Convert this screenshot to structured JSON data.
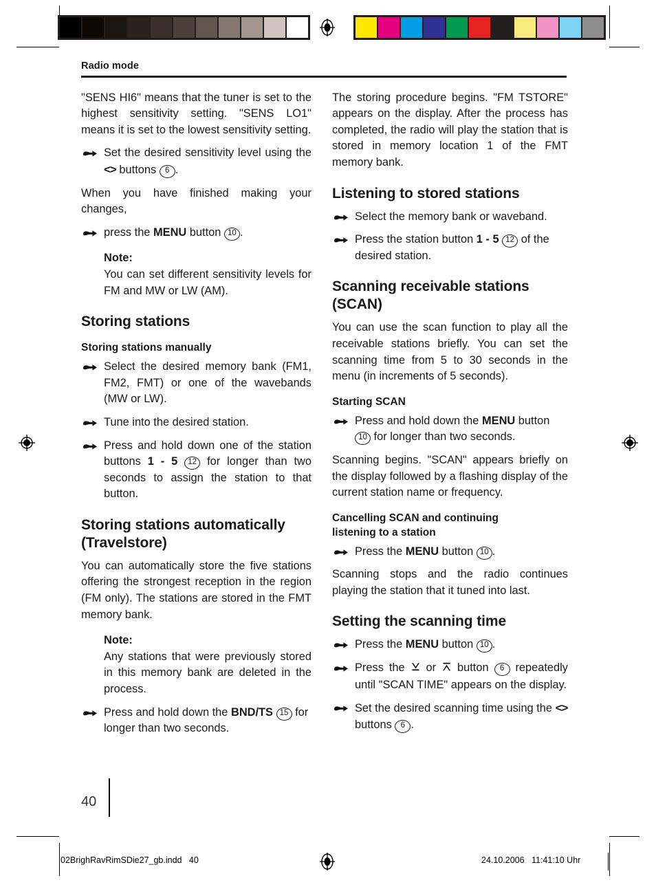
{
  "calibration": {
    "gray_scale": [
      "#000000",
      "#0d0907",
      "#1b1513",
      "#2a211e",
      "#3a2f2b",
      "#4c403b",
      "#64564f",
      "#857873",
      "#a2968f",
      "#cfc4bf",
      "#ffffff"
    ],
    "color_scale": [
      "#ffe800",
      "#e5007d",
      "#009fe3",
      "#2e3192",
      "#009a4e",
      "#e52421",
      "#231f1e",
      "#faeb7f",
      "#f293c5",
      "#7fd3f4",
      "#8e8e8e"
    ],
    "registration_mark": "registration-target"
  },
  "header": {
    "running_head": "Radio mode"
  },
  "left_column": {
    "intro": "\"SENS HI6\" means that the tuner is set to the highest sensitivity setting. \"SENS LO1\" means it is set to the lowest sensitivity setting.",
    "step_sensitivity_pre": "Set the desired sensitivity level using the ",
    "step_sensitivity_arrows": "<>",
    "step_sensitivity_mid": " buttons ",
    "step_sensitivity_ref": "6",
    "step_sensitivity_post": ".",
    "after_changes": "When you have finished making your changes,",
    "step_menu_pre": "press the ",
    "step_menu_bold": "MENU",
    "step_menu_mid": " button ",
    "step_menu_ref": "10",
    "step_menu_post": ".",
    "note1_label": "Note:",
    "note1_body": "You can set different sensitivity levels for FM and MW or LW (AM).",
    "heading_storing_stations": "Storing stations",
    "subheading_manually": "Storing stations manually",
    "step_select_bank": "Select the desired memory bank (FM1, FM2, FMT) or one of the wavebands (MW or LW).",
    "step_tune": "Tune into the desired station.",
    "step_hold_pre": "Press and hold down one of the station buttons ",
    "step_hold_bold": "1 - 5",
    "step_hold_ref": "12",
    "step_hold_post": " for longer than two seconds to assign the station to that button.",
    "heading_travelstore_line1": "Storing stations automatically",
    "heading_travelstore_line2": "(Travelstore)",
    "travelstore_body": "You can automatically store the five stations offering the strongest reception in the region (FM only). The stations are stored in the FMT memory bank.",
    "note2_label": "Note:",
    "note2_body": "Any stations that were previously stored in this memory bank are deleted in the process.",
    "step_bndts_pre": "Press and hold down the ",
    "step_bndts_bold": "BND/TS",
    "step_bndts_ref": "15",
    "step_bndts_post": " for longer than two seconds."
  },
  "right_column": {
    "storing_begins": "The storing procedure begins. \"FM TSTORE\" appears on the display. After the process has completed, the radio will play the station that is stored in memory location 1 of the FMT memory bank.",
    "heading_listening": "Listening to stored stations",
    "step_select_bank": "Select the memory bank or waveband.",
    "step_press_station_pre": "Press the station button ",
    "step_press_station_bold": "1 - 5",
    "step_press_station_ref": "12",
    "step_press_station_post": " of the desired station.",
    "heading_scan_line1": "Scanning receivable stations",
    "heading_scan_line2": "(SCAN)",
    "scan_body": "You can use the scan function to play all the receivable stations briefly. You can set the scanning time from 5 to 30 seconds in the menu (in increments of 5 seconds).",
    "subheading_starting_scan": "Starting SCAN",
    "step_hold_menu_pre": "Press and hold down the ",
    "step_hold_menu_bold": "MENU",
    "step_hold_menu_mid": " button ",
    "step_hold_menu_ref": "10",
    "step_hold_menu_post": " for longer than two seconds.",
    "scanning_begins": "Scanning begins. \"SCAN\" appears briefly on the display followed by a flashing display of the current station name or frequency.",
    "subheading_cancel_line1": "Cancelling SCAN and continuing",
    "subheading_cancel_line2": "listening to a station",
    "step_press_menu_pre": "Press the ",
    "step_press_menu_bold": "MENU",
    "step_press_menu_mid": " button ",
    "step_press_menu_ref": "10",
    "step_press_menu_post": ".",
    "scanning_stops": "Scanning stops and the radio continues playing the station that it tuned into last.",
    "heading_setting_time": "Setting the scanning time",
    "step_menu2_pre": "Press the ",
    "step_menu2_bold": "MENU",
    "step_menu2_mid": " button ",
    "step_menu2_ref": "10",
    "step_menu2_post": ".",
    "step_updown_pre": "Press the ",
    "step_updown_down": "✔",
    "step_updown_mid1": " or ",
    "step_updown_up": "✔",
    "step_updown_mid2": " button ",
    "step_updown_ref": "6",
    "step_updown_post": " repeatedly until \"SCAN TIME\" appears on the display.",
    "step_settime_pre": "Set the desired scanning time using the ",
    "step_settime_arrows": "<>",
    "step_settime_mid": " buttons ",
    "step_settime_ref": "6",
    "step_settime_post": "."
  },
  "folio": {
    "page_number": "40"
  },
  "footer": {
    "file_name": "02BrighRavRimSDie27_gb.indd   40",
    "timestamp": "24.10.2006   11:41:10 Uhr"
  }
}
